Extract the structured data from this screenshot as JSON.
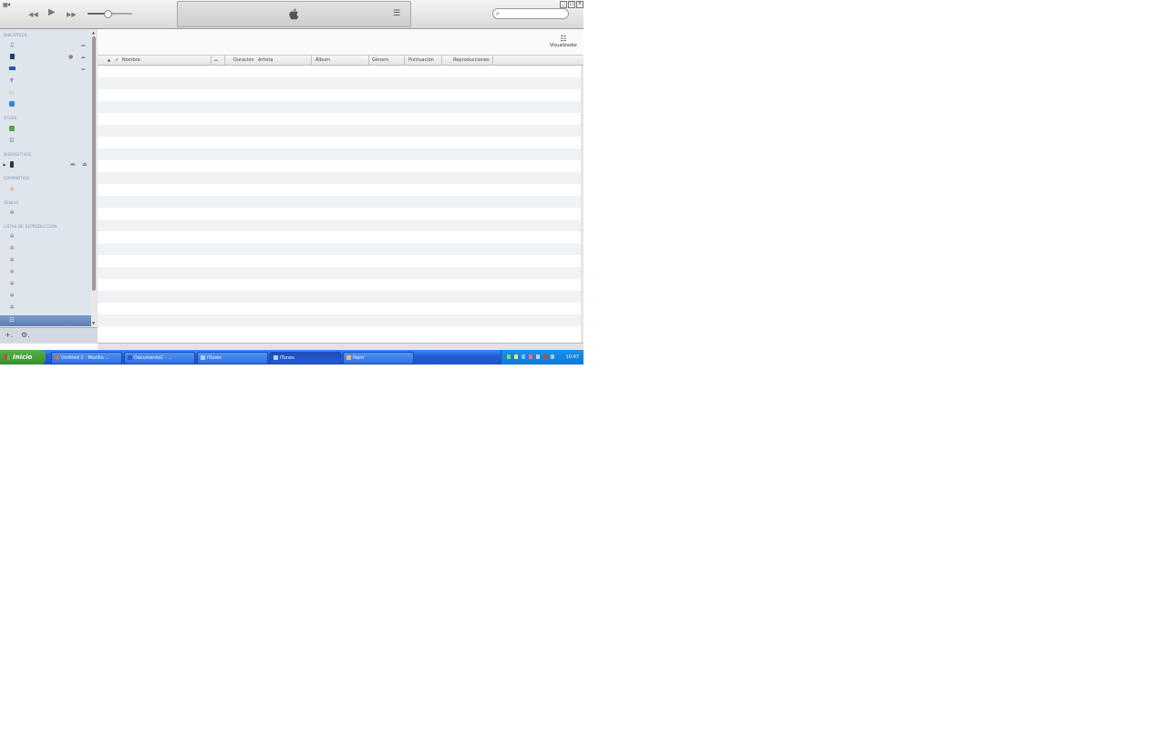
{
  "window": {
    "menu_label": "▦▾",
    "controls": [
      "_",
      "□",
      "×"
    ]
  },
  "player": {
    "rewind_icon": "◀◀",
    "play_icon": "▶",
    "forward_icon": "▶▶",
    "volume_level": 0.45,
    "list_icon": "☰"
  },
  "search": {
    "placeholder": ""
  },
  "sidebar": {
    "sections": [
      {
        "key": "biblioteca",
        "label": "BIBLIOTECA"
      },
      {
        "key": "store",
        "label": "STORE"
      },
      {
        "key": "dispositivos",
        "label": "DISPOSITIVOS"
      },
      {
        "key": "compartido",
        "label": "COMPARTIDO"
      },
      {
        "key": "genius",
        "label": "GENIUS"
      },
      {
        "key": "listas",
        "label": "LISTAS DE REPRODUCCIÓN"
      }
    ],
    "library_icons": [
      "music-icon",
      "movies-icon",
      "tv-shows-icon",
      "podcasts-icon",
      "books-icon",
      "apps-icon"
    ],
    "store_icons": [
      "itunes-store-icon",
      "ping-icon"
    ],
    "device_icon": "iphone-icon",
    "shared_icon": "home-sharing-icon",
    "genius_icon": "genius-icon",
    "playlist_count": 7,
    "selected_icon": "playlist-selected-icon",
    "add_button": "+.",
    "settings_button": "⚙."
  },
  "main": {
    "visualizer_label": "Visualizador",
    "visualizer_icon": "☷",
    "columns": [
      "Nombre",
      "Duración",
      "Artista",
      "Álbum",
      "Género",
      "Puntuación",
      "Reproducciones"
    ],
    "sort_indicator": "▲",
    "check_indicator": "✓",
    "row_count": 23
  },
  "taskbar": {
    "start_label": "Inicio",
    "tasks": [
      {
        "label": "Untitled 2 - Mozilla ...",
        "active": false
      },
      {
        "label": "Documento1 - ...",
        "active": false
      },
      {
        "label": "iTunes",
        "active": false
      },
      {
        "label": "iTunes",
        "active": true
      },
      {
        "label": "Paint",
        "active": false
      }
    ],
    "clock": "10:47"
  }
}
